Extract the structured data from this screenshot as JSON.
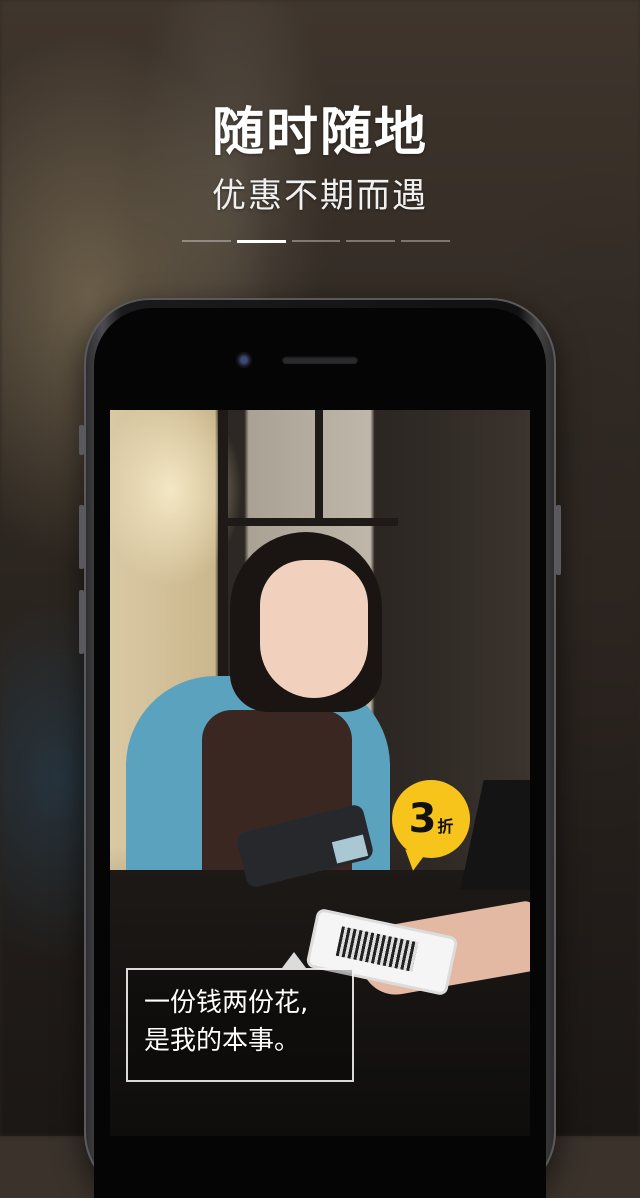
{
  "header": {
    "title": "随时随地",
    "subtitle": "优惠不期而遇"
  },
  "pager": {
    "count": 5,
    "active_index": 1
  },
  "screen": {
    "badge": {
      "number": "3",
      "unit": "折"
    },
    "caption": {
      "line1": "一份钱两份花,",
      "line2": "是我的本事。"
    }
  },
  "colors": {
    "badge": "#f7c41c",
    "title_text": "#ffffff"
  }
}
